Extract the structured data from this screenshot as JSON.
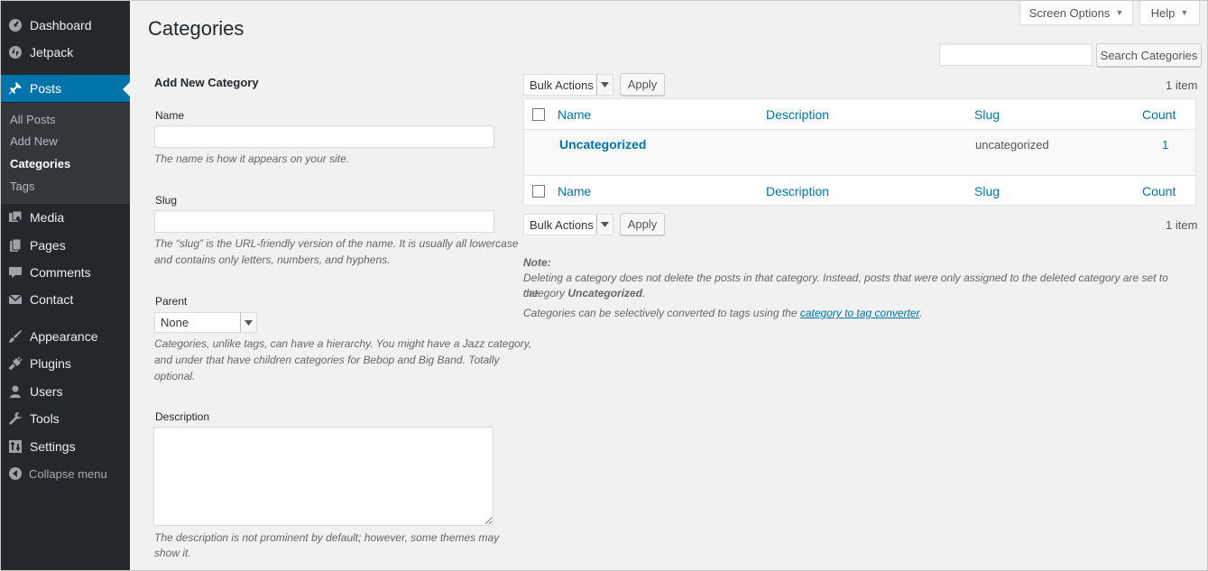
{
  "sidebar": {
    "items": [
      {
        "label": "Dashboard",
        "icon": "dashboard-icon"
      },
      {
        "label": "Jetpack",
        "icon": "jetpack-icon"
      },
      {
        "label": "Posts",
        "icon": "pin-icon",
        "current": true
      },
      {
        "label": "Media",
        "icon": "media-icon"
      },
      {
        "label": "Pages",
        "icon": "pages-icon"
      },
      {
        "label": "Comments",
        "icon": "comment-icon"
      },
      {
        "label": "Contact",
        "icon": "mail-icon"
      },
      {
        "label": "Appearance",
        "icon": "brush-icon"
      },
      {
        "label": "Plugins",
        "icon": "plug-icon"
      },
      {
        "label": "Users",
        "icon": "user-icon"
      },
      {
        "label": "Tools",
        "icon": "wrench-icon"
      },
      {
        "label": "Settings",
        "icon": "settings-icon"
      }
    ],
    "submenu": [
      "All Posts",
      "Add New",
      "Categories",
      "Tags"
    ],
    "collapse_label": "Collapse menu",
    "accent_color": "#0073aa",
    "bg_color": "#23282d"
  },
  "header": {
    "title": "Categories",
    "screen_options": "Screen Options",
    "help": "Help"
  },
  "search": {
    "value": "",
    "button": "Search Categories"
  },
  "form": {
    "title": "Add New Category",
    "name_label": "Name",
    "name_value": "",
    "name_help": "The name is how it appears on your site.",
    "slug_label": "Slug",
    "slug_value": "",
    "slug_help_1": "The “slug” is the URL-friendly version of the name. It is usually all lowercase",
    "slug_help_2": "and contains only letters, numbers, and hyphens.",
    "parent_label": "Parent",
    "parent_value": "None",
    "parent_help_1": "Categories, unlike tags, can have a hierarchy. You might have a Jazz category,",
    "parent_help_2": "and under that have children categories for Bebop and Big Band. Totally",
    "parent_help_3": "optional.",
    "description_label": "Description",
    "description_value": "",
    "description_help_1": "The description is not prominent by default; however, some themes may",
    "description_help_2": "show it."
  },
  "table": {
    "bulk_actions": "Bulk Actions",
    "apply": "Apply",
    "item_count": "1 item",
    "columns": [
      "Name",
      "Description",
      "Slug",
      "Count"
    ],
    "rows": [
      {
        "name": "Uncategorized",
        "description": "",
        "slug": "uncategorized",
        "count": "1"
      }
    ]
  },
  "note": {
    "title": "Note:",
    "line1": "Deleting a category does not delete the posts in that category. Instead, posts that were only assigned to the deleted category are set to the",
    "line2_prefix": "category ",
    "line2_bold": "Uncategorized",
    "line2_suffix": ".",
    "line3_prefix": "Categories can be selectively converted to tags using the ",
    "line3_link": "category to tag converter",
    "line3_suffix": "."
  }
}
